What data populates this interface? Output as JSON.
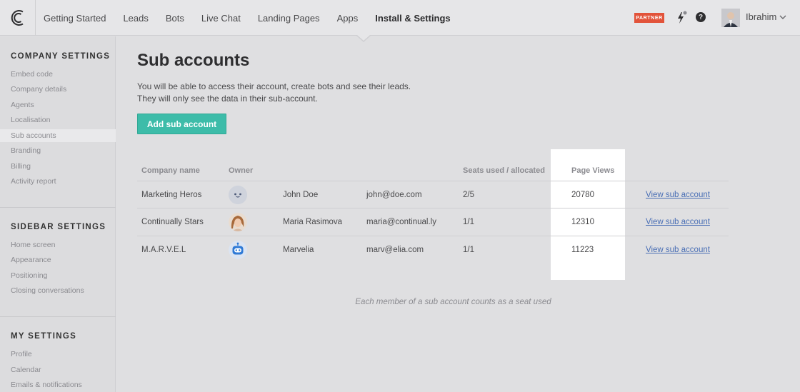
{
  "nav": {
    "items": [
      "Getting Started",
      "Leads",
      "Bots",
      "Live Chat",
      "Landing Pages",
      "Apps",
      "Install & Settings"
    ],
    "active_index": 6,
    "partner_badge": "PARTNER",
    "help_glyph": "?",
    "user_name": "Ibrahim"
  },
  "sidebar": {
    "sections": [
      {
        "title": "COMPANY SETTINGS",
        "items": [
          "Embed code",
          "Company details",
          "Agents",
          "Localisation",
          "Sub accounts",
          "Branding",
          "Billing",
          "Activity report"
        ],
        "active_index": 4
      },
      {
        "title": "SIDEBAR SETTINGS",
        "items": [
          "Home screen",
          "Appearance",
          "Positioning",
          "Closing conversations"
        ]
      },
      {
        "title": "MY SETTINGS",
        "items": [
          "Profile",
          "Calendar",
          "Emails & notifications"
        ]
      }
    ]
  },
  "main": {
    "title": "Sub accounts",
    "intro_line1": "You will be able to access their account, create bots and see their leads.",
    "intro_line2": "They will only see the data in their sub-account.",
    "add_button": "Add sub account",
    "table": {
      "headers": {
        "company": "Company name",
        "owner": "Owner",
        "seats": "Seats used / allocated",
        "views": "Page Views"
      },
      "rows": [
        {
          "company": "Marketing Heros",
          "avatar": "bot-face-icon",
          "owner": "John Doe",
          "email": "john@doe.com",
          "seats": "2/5",
          "views": "20780",
          "action": "View sub account"
        },
        {
          "company": "Continually Stars",
          "avatar": "person-photo",
          "owner": "Maria Rasimova",
          "email": "maria@continual.ly",
          "seats": "1/1",
          "views": "12310",
          "action": "View sub account"
        },
        {
          "company": "M.A.R.V.E.L",
          "avatar": "robot-icon",
          "owner": "Marvelia",
          "email": "marv@elia.com",
          "seats": "1/1",
          "views": "11223",
          "action": "View sub account"
        }
      ]
    },
    "footnote": "Each member of a sub account counts as a seat used"
  },
  "colors": {
    "accent": "#3dbca9",
    "partner": "#e2533a",
    "link": "#4a6fb5"
  }
}
